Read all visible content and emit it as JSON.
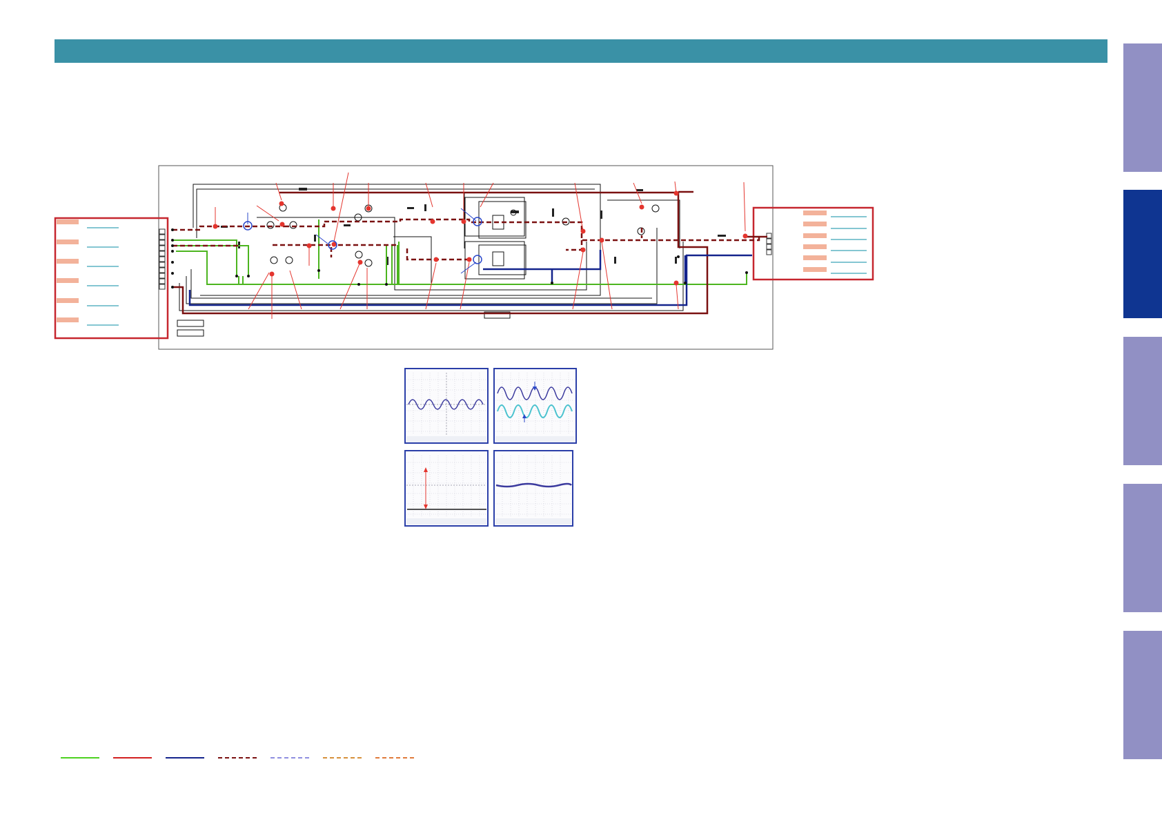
{
  "colors": {
    "header": "#3a91a6",
    "side_tab": "#9190c4",
    "side_tab_active": "#0f3591",
    "connector_frame": "#c6262e",
    "connector_pad": "#f3b29a",
    "connector_line": "#3aa3b7",
    "green_net": "#4cb51f",
    "red_net": "#d21f1f",
    "blue_net": "#13238c",
    "dark_red_net": "#7a1010",
    "probe_red": "#e4352e",
    "probe_blue": "#2a47c9",
    "scope_frame": "#2a3ea8",
    "trace_ch1": "#3b3a9e",
    "trace_ch2": "#4cc3cf"
  },
  "side_tabs": [
    {
      "id": "tab-1",
      "active": false
    },
    {
      "id": "tab-2",
      "active": true
    },
    {
      "id": "tab-3",
      "active": false
    },
    {
      "id": "tab-4",
      "active": false
    },
    {
      "id": "tab-5",
      "active": false
    }
  ],
  "legend": [
    {
      "color": "#4cd11f",
      "style": "solid"
    },
    {
      "color": "#d21f1f",
      "style": "solid"
    },
    {
      "color": "#13238c",
      "style": "solid"
    },
    {
      "color": "#7a1010",
      "style": "dashed"
    },
    {
      "color": "#8e8ee0",
      "style": "dashed"
    },
    {
      "color": "#d6903a",
      "style": "dashed"
    },
    {
      "color": "#e07a3a",
      "style": "dashed"
    }
  ],
  "scopes": [
    {
      "id": "scope-1",
      "waveform": "sine",
      "channels": 1
    },
    {
      "id": "scope-2",
      "waveform": "sine",
      "channels": 2
    },
    {
      "id": "scope-3",
      "waveform": "dc-level",
      "channels": 1
    },
    {
      "id": "scope-4",
      "waveform": "flat-noise",
      "channels": 1
    }
  ],
  "icons": {
    "transistor": "transistor-symbol",
    "probe_point": "test-point-marker",
    "ic_block": "ic-block"
  }
}
